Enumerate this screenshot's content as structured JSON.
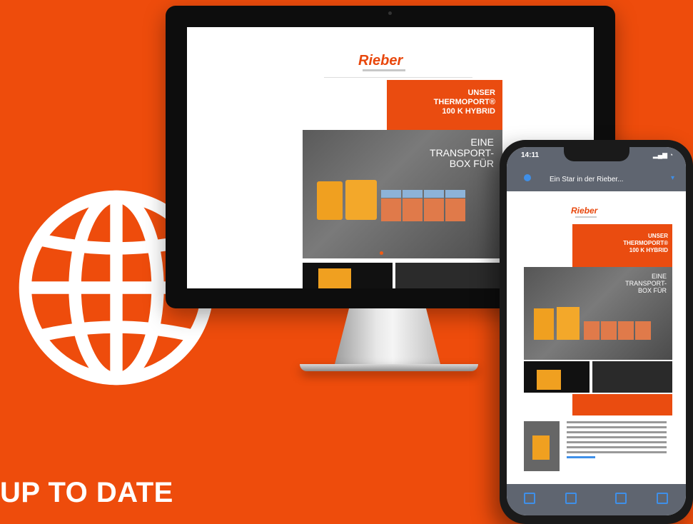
{
  "headline": "UP TO DATE",
  "colors": {
    "background": "#ee4c0c",
    "brand": "#e8470c"
  },
  "icons": {
    "globe": "globe-icon"
  },
  "newsletter": {
    "logo": "Rieber",
    "hero_lines": [
      "UNSER",
      "THERMOPORT®",
      "100 K HYBRID"
    ],
    "photo_lines": [
      "EINE",
      "TRANSPORT-",
      "BOX FÜR"
    ]
  },
  "phone": {
    "time": "14:11",
    "mail_subject": "Ein Star in der Rieber..."
  }
}
